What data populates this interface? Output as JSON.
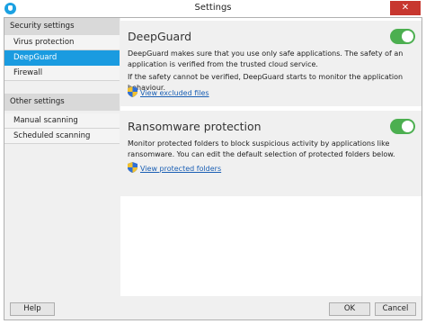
{
  "window": {
    "title": "Settings",
    "close_glyph": "✕"
  },
  "sidebar": {
    "groups": [
      {
        "header": "Security settings",
        "items": [
          {
            "label": "Virus protection",
            "selected": false
          },
          {
            "label": "DeepGuard",
            "selected": true
          },
          {
            "label": "Firewall",
            "selected": false
          }
        ]
      },
      {
        "header": "Other settings",
        "items": [
          {
            "label": "Manual scanning",
            "selected": false
          },
          {
            "label": "Scheduled scanning",
            "selected": false
          }
        ]
      }
    ]
  },
  "deepguard": {
    "title": "DeepGuard",
    "enabled": true,
    "desc1": "DeepGuard makes sure that you use only safe applications. The safety of an application is verified from the trusted cloud service.",
    "desc2": "If the safety cannot be verified, DeepGuard starts to monitor the application behaviour.",
    "link": "View excluded files"
  },
  "ransomware": {
    "title": "Ransomware protection",
    "enabled": true,
    "desc": "Monitor protected folders to block suspicious activity by applications like ransomware. You can edit the default selection of protected folders below.",
    "link": "View protected folders"
  },
  "footer": {
    "help": "Help",
    "ok": "OK",
    "cancel": "Cancel"
  },
  "colors": {
    "accent": "#1a9be0",
    "toggle_on": "#4caf50",
    "close": "#c7372f",
    "link": "#1a5fb4"
  }
}
